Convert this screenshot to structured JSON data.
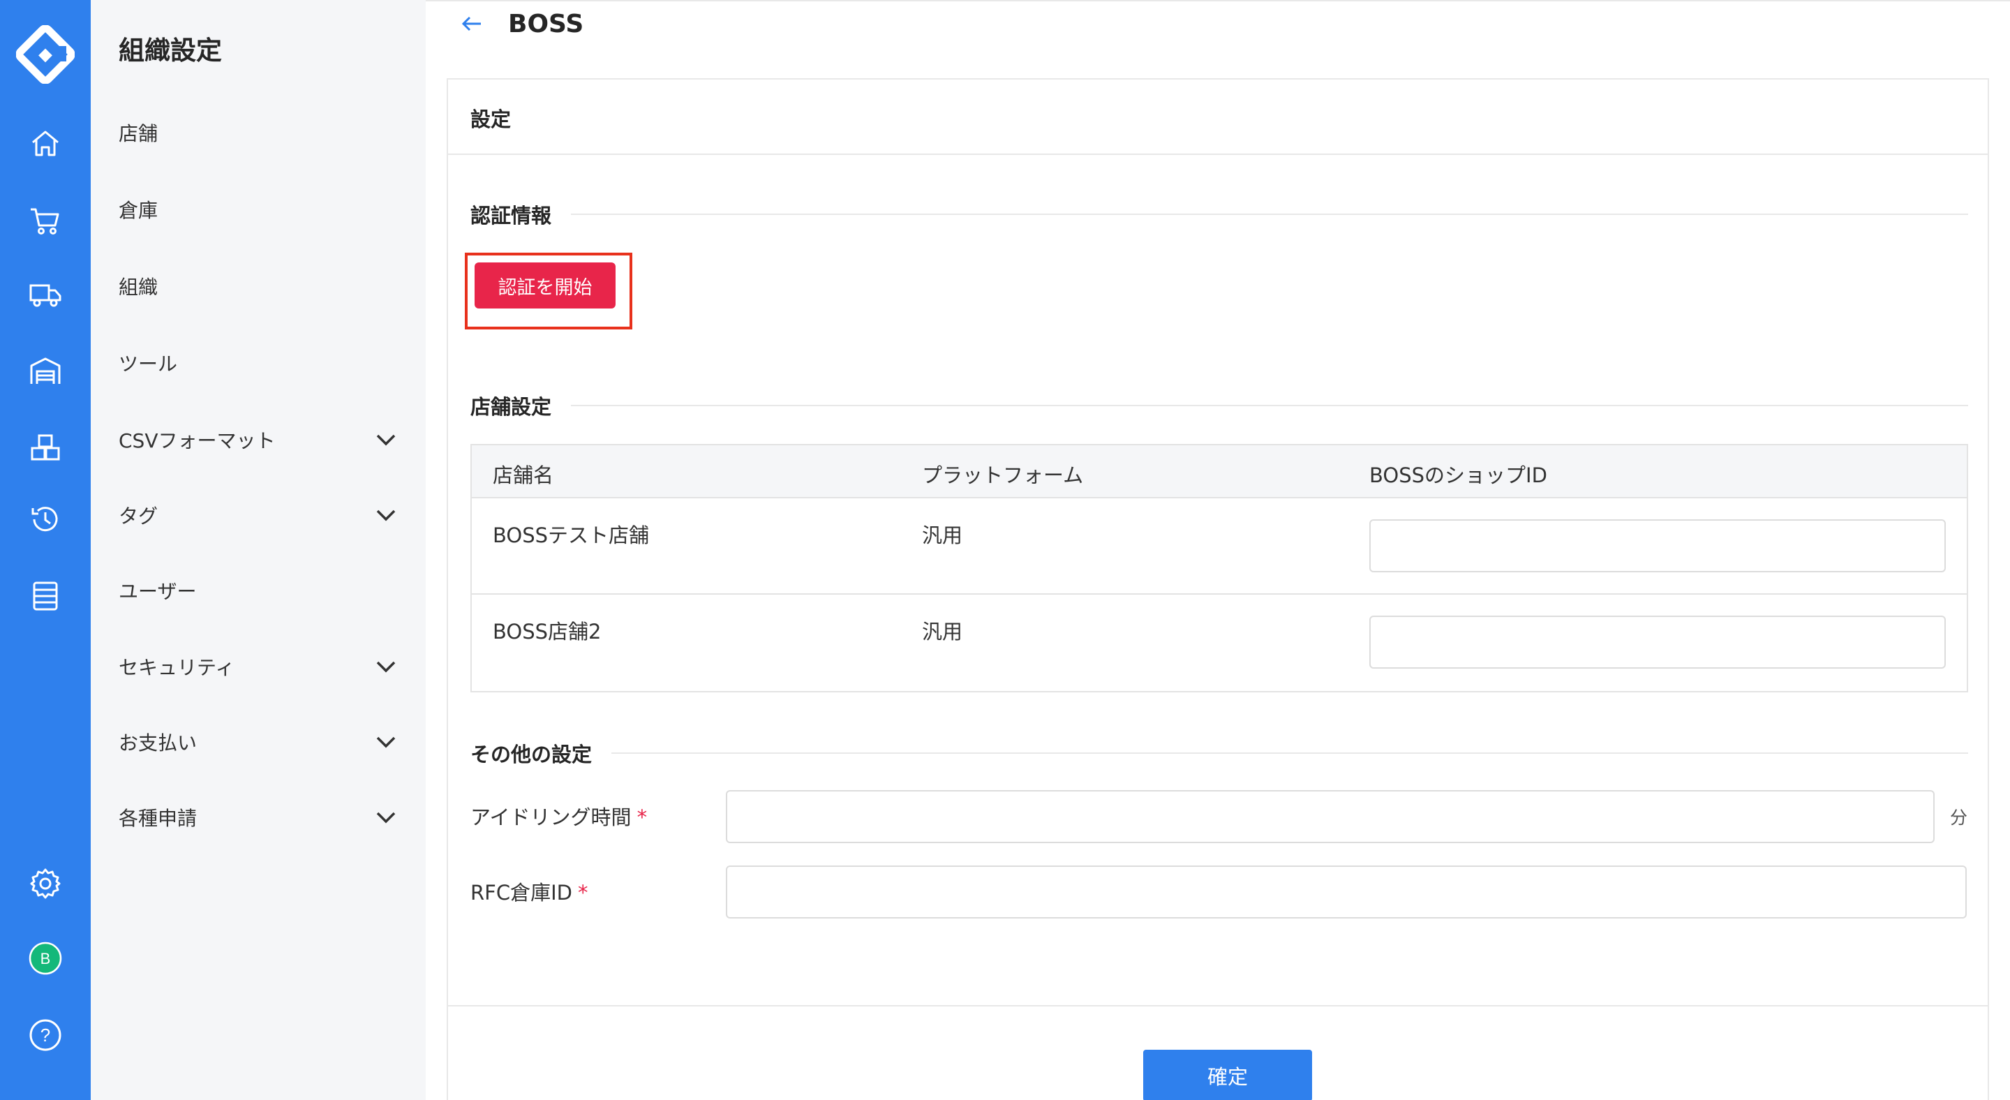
{
  "app": {
    "logo_icon": "diamond-logo-icon",
    "accent_color": "#2f80ed",
    "rail_icons": [
      "home-icon",
      "cart-icon",
      "truck-icon",
      "warehouse-icon",
      "boxes-icon",
      "history-icon",
      "list-icon",
      "settings-icon",
      "avatar-icon",
      "help-icon"
    ],
    "avatar_letter": "B",
    "avatar_color": "#14b87a"
  },
  "sidebar": {
    "title": "組織設定",
    "items": [
      {
        "label": "店舗",
        "expandable": false
      },
      {
        "label": "倉庫",
        "expandable": false
      },
      {
        "label": "組織",
        "expandable": false
      },
      {
        "label": "ツール",
        "expandable": false
      },
      {
        "label": "CSVフォーマット",
        "expandable": true
      },
      {
        "label": "タグ",
        "expandable": true
      },
      {
        "label": "ユーザー",
        "expandable": false
      },
      {
        "label": "セキュリティ",
        "expandable": true
      },
      {
        "label": "お支払い",
        "expandable": true
      },
      {
        "label": "各種申請",
        "expandable": true
      }
    ]
  },
  "header": {
    "title": "BOSS"
  },
  "card": {
    "title": "設定"
  },
  "auth": {
    "section_title": "認証情報",
    "button_label": "認証を開始",
    "button_color": "#e8254a",
    "highlight_color": "#e8311c"
  },
  "shops": {
    "section_title": "店舗設定",
    "columns": [
      "店舗名",
      "プラットフォーム",
      "BOSSのショップID"
    ],
    "rows": [
      {
        "name": "BOSSテスト店舗",
        "platform": "汎用",
        "shop_id": ""
      },
      {
        "name": "BOSS店舗2",
        "platform": "汎用",
        "shop_id": ""
      }
    ]
  },
  "other": {
    "section_title": "その他の設定",
    "idle_label": "アイドリング時間",
    "idle_value": "",
    "idle_unit": "分",
    "rfc_label": "RFC倉庫ID",
    "rfc_value": "",
    "required_mark": "*"
  },
  "footer": {
    "confirm_label": "確定"
  }
}
